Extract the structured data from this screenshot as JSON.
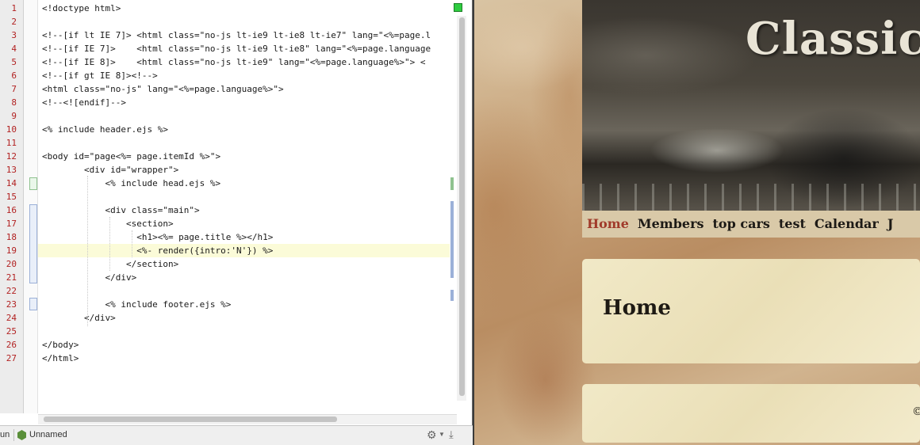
{
  "editor": {
    "lines": [
      {
        "num": "1",
        "text": "<!doctype html>"
      },
      {
        "num": "2",
        "text": ""
      },
      {
        "num": "3",
        "text": "<!--[if lt IE 7]> <html class=\"no-js lt-ie9 lt-ie8 lt-ie7\" lang=\"<%=page.l"
      },
      {
        "num": "4",
        "text": "<!--[if IE 7]>    <html class=\"no-js lt-ie9 lt-ie8\" lang=\"<%=page.language"
      },
      {
        "num": "5",
        "text": "<!--[if IE 8]>    <html class=\"no-js lt-ie9\" lang=\"<%=page.language%>\"> <"
      },
      {
        "num": "6",
        "text": "<!--[if gt IE 8]><!-->"
      },
      {
        "num": "7",
        "text": "<html class=\"no-js\" lang=\"<%=page.language%>\">"
      },
      {
        "num": "8",
        "text": "<!--<![endif]-->"
      },
      {
        "num": "9",
        "text": ""
      },
      {
        "num": "10",
        "text": "<% include header.ejs %>"
      },
      {
        "num": "11",
        "text": ""
      },
      {
        "num": "12",
        "text": "<body id=\"page<%= page.itemId %>\">"
      },
      {
        "num": "13",
        "text": "        <div id=\"wrapper\">"
      },
      {
        "num": "14",
        "text": "            <% include head.ejs %>"
      },
      {
        "num": "15",
        "text": ""
      },
      {
        "num": "16",
        "text": "            <div class=\"main\">"
      },
      {
        "num": "17",
        "text": "                <section>"
      },
      {
        "num": "18",
        "text": "                  <h1><%= page.title %></h1>"
      },
      {
        "num": "19",
        "text": "                  <%- render({intro:'N'}) %>"
      },
      {
        "num": "20",
        "text": "                </section>"
      },
      {
        "num": "21",
        "text": "            </div>"
      },
      {
        "num": "22",
        "text": ""
      },
      {
        "num": "23",
        "text": "            <% include footer.ejs %>"
      },
      {
        "num": "24",
        "text": "        </div>"
      },
      {
        "num": "25",
        "text": ""
      },
      {
        "num": "26",
        "text": "</body>"
      },
      {
        "num": "27",
        "text": "</html>"
      }
    ],
    "status": {
      "run_label": "un",
      "config_name": "Unnamed",
      "gear_icon": "gear-icon",
      "download_icon": "download-icon"
    }
  },
  "preview": {
    "site_title": "Classic",
    "nav": [
      "Home",
      "Members",
      "top cars",
      "test",
      "Calendar",
      "J"
    ],
    "active_nav": "Home",
    "page_heading": "Home",
    "footer_text": "©",
    "colors": {
      "nav_active": "#a03a2a",
      "panel": "#efe6c2"
    }
  }
}
